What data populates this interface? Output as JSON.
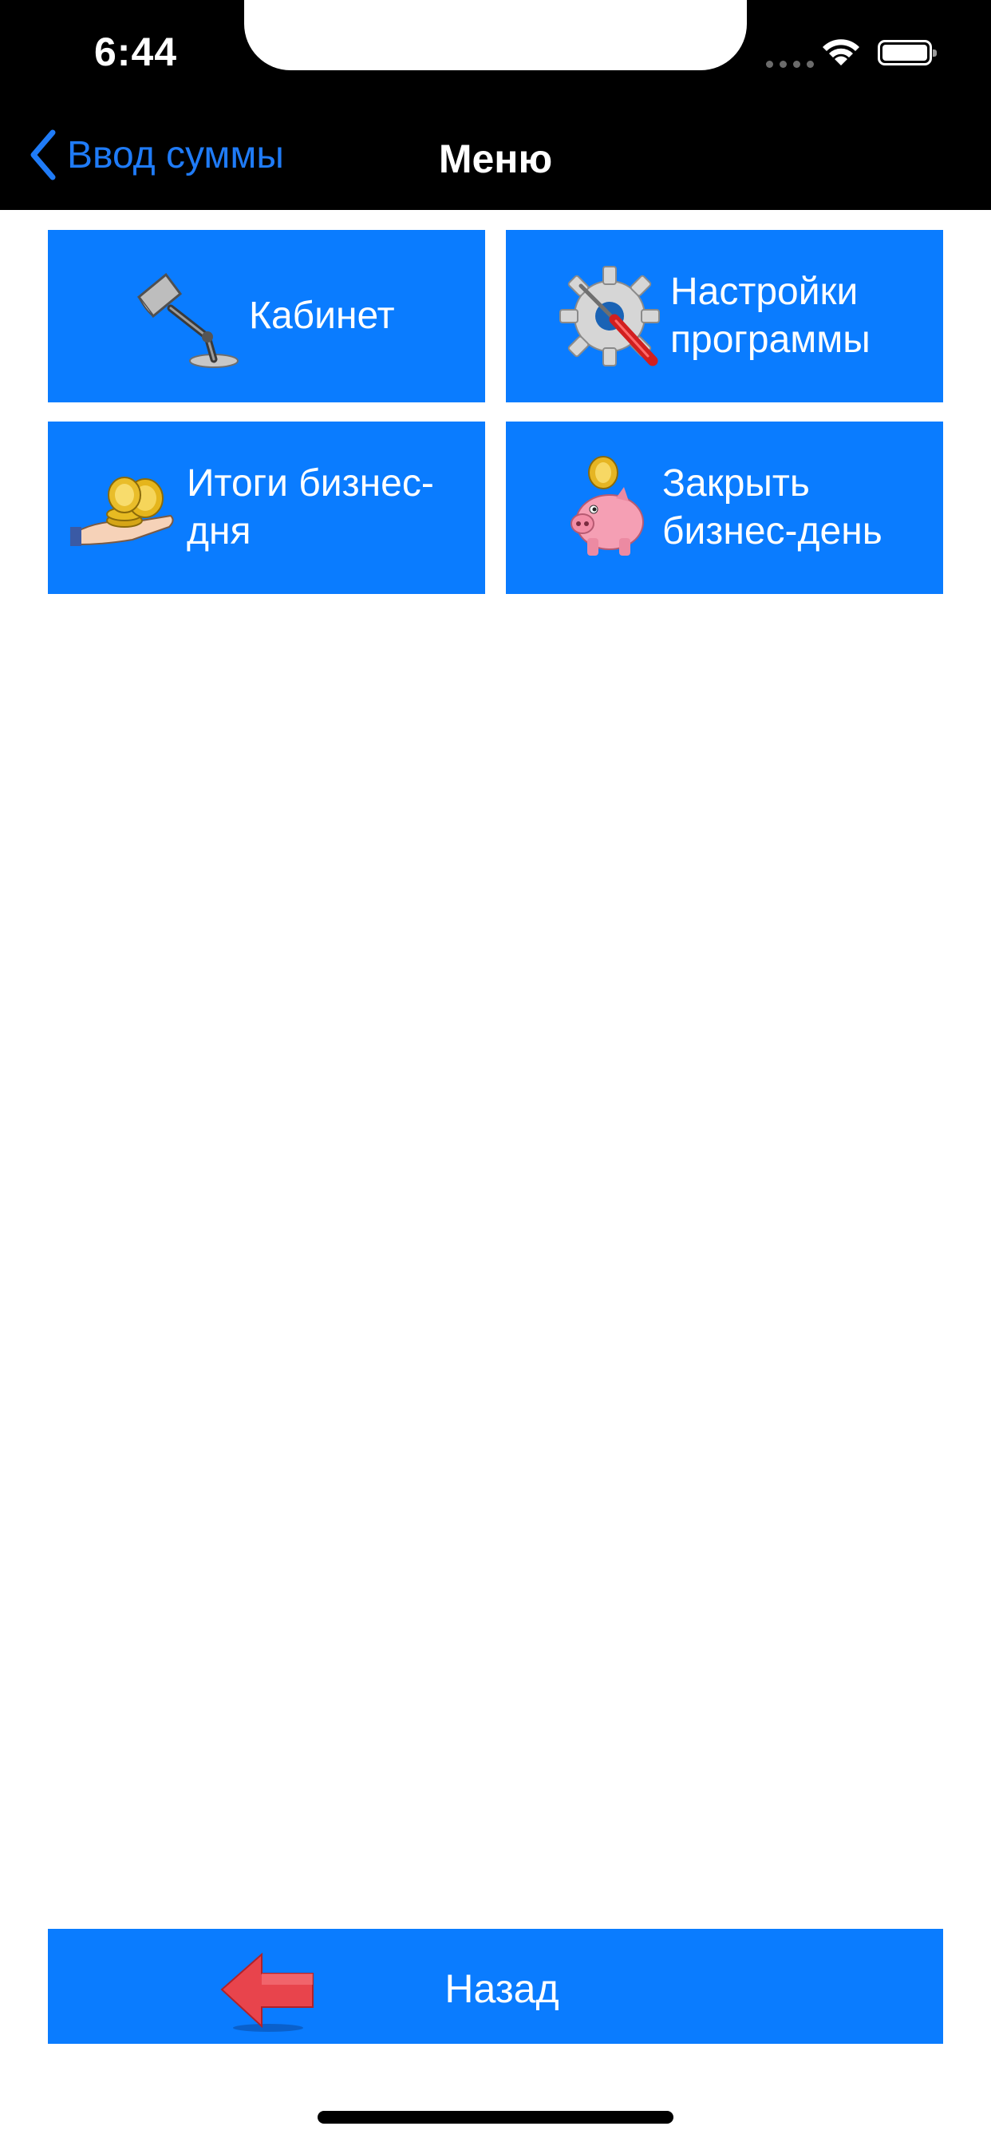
{
  "status_bar": {
    "time": "6:44"
  },
  "nav": {
    "back_label": "Ввод суммы",
    "title": "Меню"
  },
  "menu": {
    "tiles": [
      {
        "label": "Кабинет",
        "icon": "desk-lamp-icon"
      },
      {
        "label": "Настройки программы",
        "icon": "settings-gear-screwdriver-icon"
      },
      {
        "label": "Итоги бизнес-дня",
        "icon": "coins-in-hand-icon"
      },
      {
        "label": "Закрыть бизнес-день",
        "icon": "piggy-bank-icon"
      }
    ]
  },
  "footer": {
    "back_button_label": "Назад",
    "icon": "left-arrow-icon"
  },
  "colors": {
    "accent": "#0a7cff",
    "nav_bg": "#000000",
    "back_link": "#1f7bf7"
  }
}
